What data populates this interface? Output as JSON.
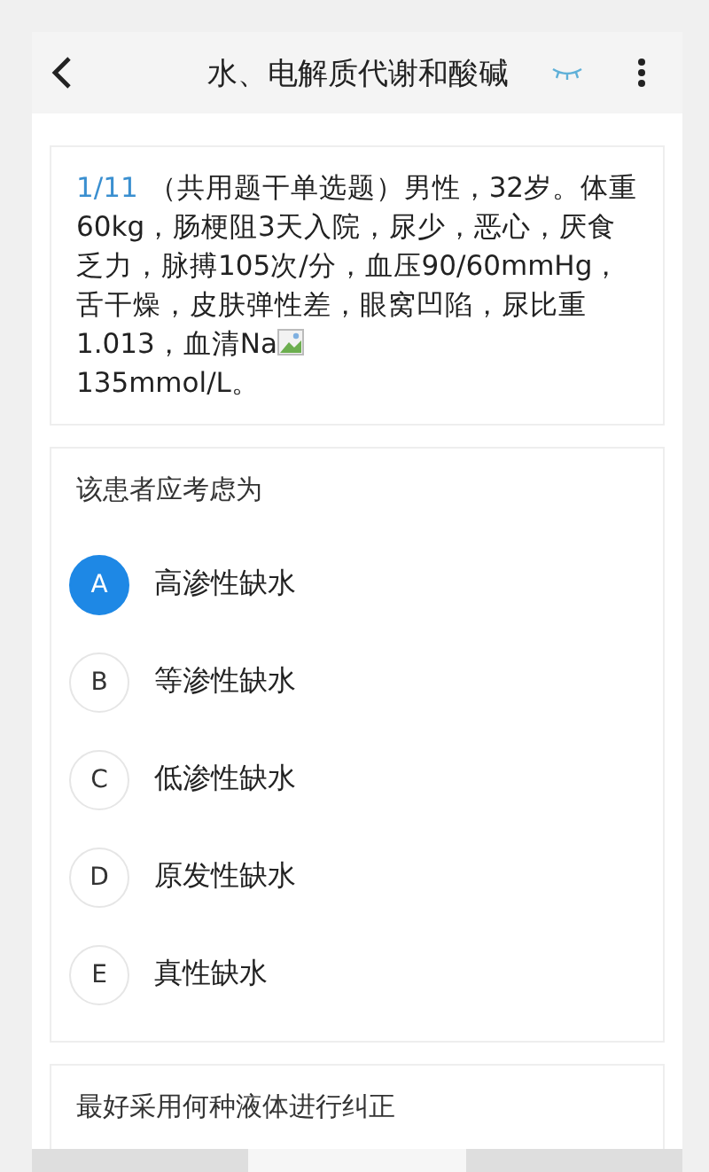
{
  "header": {
    "title": "水、电解质代谢和酸碱"
  },
  "question": {
    "number": "1/11",
    "stem_before_image": "（共用题干单选题）男性，32岁。体重60kg，肠梗阻3天入院，尿少，恶心，厌食乏力，脉搏105次/分，血压90/60mmHg，舌干燥，皮肤弹性差，眼窝凹陷，尿比重1.013，血清Na",
    "stem_after_image": "135mmol/L。"
  },
  "sub_questions": [
    {
      "prompt": "该患者应考虑为",
      "options": [
        {
          "letter": "A",
          "text": "高渗性缺水",
          "selected": true
        },
        {
          "letter": "B",
          "text": "等渗性缺水",
          "selected": false
        },
        {
          "letter": "C",
          "text": "低渗性缺水",
          "selected": false
        },
        {
          "letter": "D",
          "text": "原发性缺水",
          "selected": false
        },
        {
          "letter": "E",
          "text": "真性缺水",
          "selected": false
        }
      ]
    },
    {
      "prompt": "最好采用何种液体进行纠正"
    }
  ],
  "bottom_bar": [
    {
      "selected": false
    },
    {
      "selected": true
    },
    {
      "selected": false
    }
  ]
}
